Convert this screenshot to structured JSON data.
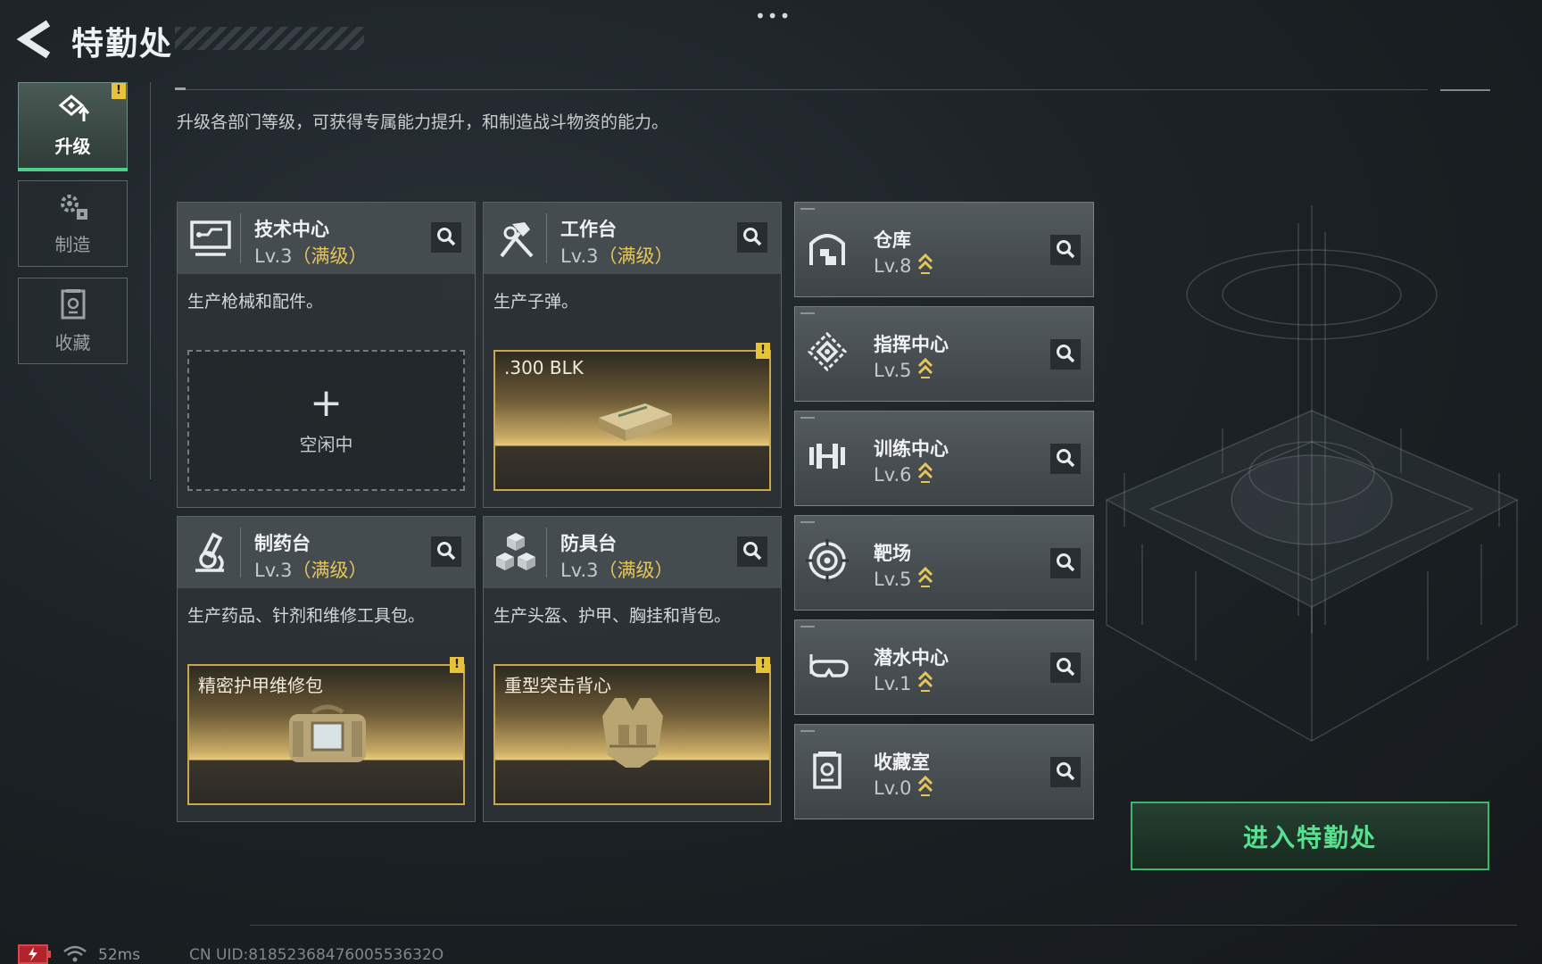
{
  "header": {
    "title": "特勤处",
    "subtitle": "升级各部门等级，可获得专属能力提升，和制造战斗物资的能力。"
  },
  "sidebar": {
    "items": [
      {
        "label": "升级",
        "icon": "upgrade-icon",
        "active": true,
        "alert": "!"
      },
      {
        "label": "制造",
        "icon": "gears-icon",
        "active": false
      },
      {
        "label": "收藏",
        "icon": "collection-icon",
        "active": false
      }
    ]
  },
  "production": [
    {
      "name": "技术中心",
      "level": "Lv.3",
      "max": "（满级）",
      "desc": "生产枪械和配件。",
      "slot": {
        "type": "idle",
        "plus": "+",
        "label": "空闲中"
      }
    },
    {
      "name": "工作台",
      "level": "Lv.3",
      "max": "（满级）",
      "desc": "生产子弹。",
      "slot": {
        "type": "item",
        "label": ".300 BLK",
        "alert": "!"
      }
    },
    {
      "name": "制药台",
      "level": "Lv.3",
      "max": "（满级）",
      "desc": "生产药品、针剂和维修工具包。",
      "slot": {
        "type": "item",
        "label": "精密护甲维修包",
        "alert": "!"
      }
    },
    {
      "name": "防具台",
      "level": "Lv.3",
      "max": "（满级）",
      "desc": "生产头盔、护甲、胸挂和背包。",
      "slot": {
        "type": "item",
        "label": "重型突击背心",
        "alert": "!"
      }
    }
  ],
  "buildings": [
    {
      "name": "仓库",
      "level": "Lv.8",
      "icon": "warehouse-icon"
    },
    {
      "name": "指挥中心",
      "level": "Lv.5",
      "icon": "command-center-icon"
    },
    {
      "name": "训练中心",
      "level": "Lv.6",
      "icon": "dumbbell-icon"
    },
    {
      "name": "靶场",
      "level": "Lv.5",
      "icon": "target-icon"
    },
    {
      "name": "潜水中心",
      "level": "Lv.1",
      "icon": "diving-mask-icon"
    },
    {
      "name": "收藏室",
      "level": "Lv.0",
      "icon": "collection-room-icon"
    }
  ],
  "enter_button": "进入特勤处",
  "top_dots": "•••",
  "status": {
    "ping": "52ms",
    "uid": "CN UID:8185236847600553632O"
  },
  "colors": {
    "accent_green": "#4fd08a",
    "max_level_gold": "#e6c65a",
    "alert_yellow": "#e8c33a"
  }
}
